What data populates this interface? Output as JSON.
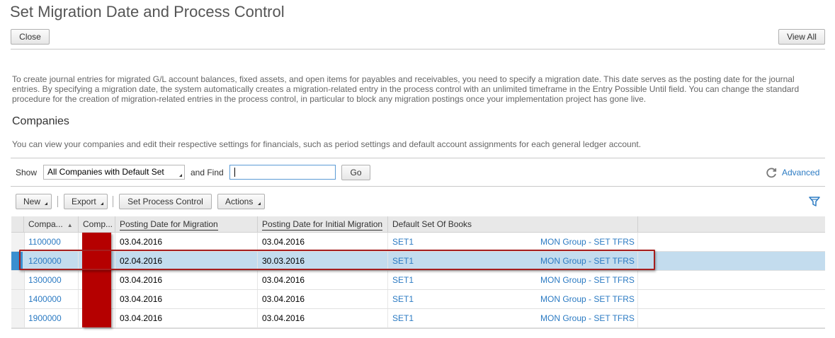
{
  "page": {
    "title": "Set Migration Date and Process Control",
    "close_label": "Close",
    "view_all_label": "View All",
    "intro": "To create journal entries for migrated G/L account balances, fixed assets, and open items for payables and receivables, you need to specify a migration date. This date serves as the posting date for the journal entries. By specifying a migration date, the system automatically creates a migration-related entry in the process control with an unlimited timeframe in the Entry Possible Until field. You can change the standard procedure for the creation of migration-related entries in the process control, in particular to block any migration postings once your implementation project has gone live."
  },
  "companies": {
    "title": "Companies",
    "description": "You can view your companies and edit their respective settings for financials, such as period settings and default account assignments for each general ledger account.",
    "filter": {
      "show_label": "Show",
      "show_value": "All Companies with Default Set",
      "find_label": "and Find",
      "find_value": "",
      "go_label": "Go",
      "advanced_label": "Advanced"
    },
    "toolbar": {
      "new_label": "New",
      "export_label": "Export",
      "set_process_control_label": "Set Process Control",
      "actions_label": "Actions"
    },
    "columns": [
      "Compa...",
      "Comp...",
      "Posting Date for Migration",
      "Posting Date for Initial Migration",
      "Default Set Of Books"
    ],
    "rows": [
      {
        "company": "1100000",
        "comp_name": "",
        "posting_date": "03.04.2016",
        "initial_date": "03.04.2016",
        "set": "SET1",
        "set_desc": "MON Group - SET TFRS"
      },
      {
        "company": "1200000",
        "comp_name": "",
        "posting_date": "02.04.2016",
        "initial_date": "30.03.2016",
        "set": "SET1",
        "set_desc": "MON Group - SET TFRS"
      },
      {
        "company": "1300000",
        "comp_name": "",
        "posting_date": "03.04.2016",
        "initial_date": "03.04.2016",
        "set": "SET1",
        "set_desc": "MON Group - SET TFRS"
      },
      {
        "company": "1400000",
        "comp_name": "",
        "posting_date": "03.04.2016",
        "initial_date": "03.04.2016",
        "set": "SET1",
        "set_desc": "MON Group - SET TFRS"
      },
      {
        "company": "1900000",
        "comp_name": "",
        "posting_date": "03.04.2016",
        "initial_date": "03.04.2016",
        "set": "SET1",
        "set_desc": "MON Group - SET TFRS"
      }
    ],
    "selected_row": 1
  },
  "colors": {
    "link": "#2c7bc3",
    "selection": "#c3dcee",
    "redaction": "#b50000",
    "highlight_border": "#a61e1e"
  },
  "icons": {
    "refresh": "refresh-icon",
    "filter": "filter-icon",
    "sort": "sort-ascending-icon"
  }
}
